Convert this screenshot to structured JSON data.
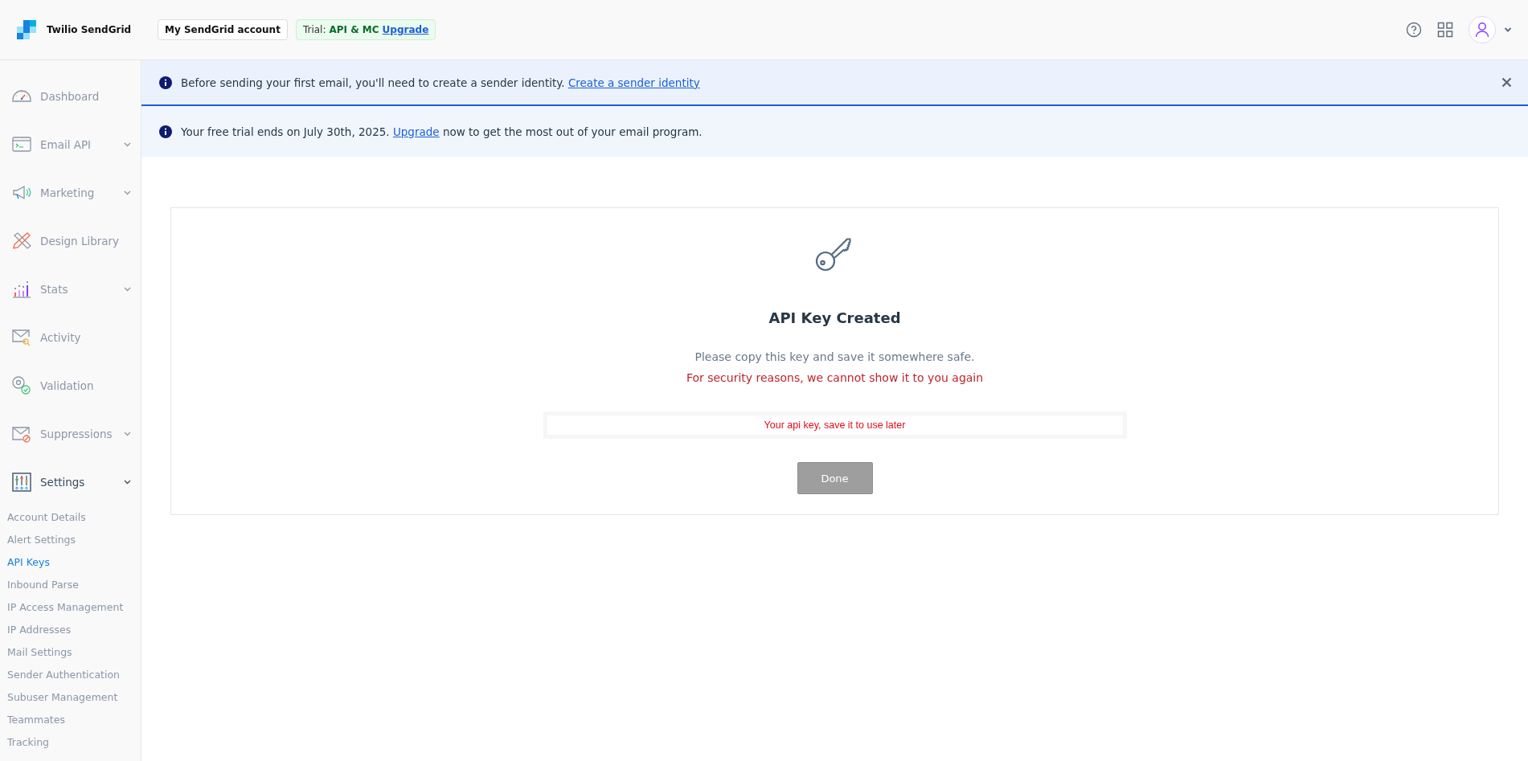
{
  "header": {
    "brand": "Twilio SendGrid",
    "account_button": "My SendGrid account",
    "trial": {
      "label": "Trial:",
      "plan": "API & MC",
      "link": "Upgrade"
    }
  },
  "sidebar": {
    "items": [
      {
        "label": "Dashboard",
        "expandable": false,
        "expanded": false
      },
      {
        "label": "Email API",
        "expandable": true,
        "expanded": false
      },
      {
        "label": "Marketing",
        "expandable": true,
        "expanded": false
      },
      {
        "label": "Design Library",
        "expandable": false,
        "expanded": false
      },
      {
        "label": "Stats",
        "expandable": true,
        "expanded": false
      },
      {
        "label": "Activity",
        "expandable": false,
        "expanded": false
      },
      {
        "label": "Validation",
        "expandable": false,
        "expanded": false
      },
      {
        "label": "Suppressions",
        "expandable": true,
        "expanded": false
      },
      {
        "label": "Settings",
        "expandable": true,
        "expanded": true,
        "children": [
          {
            "label": "Account Details",
            "selected": false
          },
          {
            "label": "Alert Settings",
            "selected": false
          },
          {
            "label": "API Keys",
            "selected": true
          },
          {
            "label": "Inbound Parse",
            "selected": false
          },
          {
            "label": "IP Access Management",
            "selected": false
          },
          {
            "label": "IP Addresses",
            "selected": false
          },
          {
            "label": "Mail Settings",
            "selected": false
          },
          {
            "label": "Sender Authentication",
            "selected": false
          },
          {
            "label": "Subuser Management",
            "selected": false
          },
          {
            "label": "Teammates",
            "selected": false
          },
          {
            "label": "Tracking",
            "selected": false
          }
        ]
      }
    ]
  },
  "banners": [
    {
      "text": "Before sending your first email, you'll need to create a sender identity.",
      "link": "Create a sender identity",
      "closable": true
    },
    {
      "text": "Your free trial ends on July 30th, 2025.",
      "link": "Upgrade",
      "after": "now to get the most out of your email program.",
      "closable": false
    }
  ],
  "card": {
    "title": "API Key Created",
    "message": "Please copy this key and save it somewhere safe.",
    "warning": "For security reasons, we cannot show it to you again",
    "key_field": {
      "value": "Your api key, save it to use later"
    },
    "done_button": "Done"
  }
}
